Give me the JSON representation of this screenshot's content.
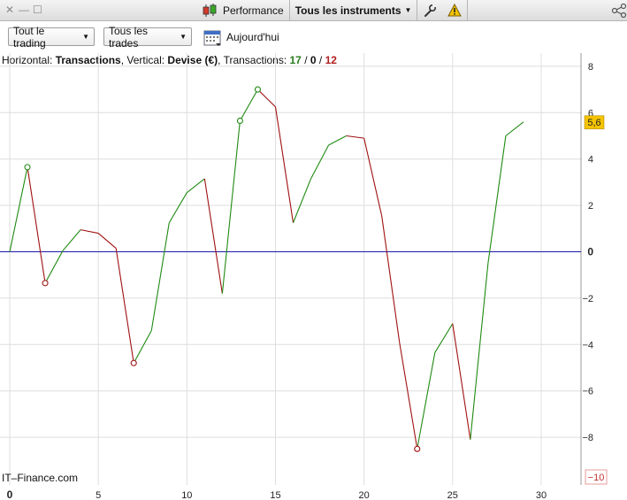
{
  "toolbar": {
    "performance_label": "Performance",
    "instruments_label": "Tous les instruments"
  },
  "filters": {
    "trading_label": "Tout le trading",
    "trades_label": "Tous les trades",
    "date_label": "Aujourd'hui"
  },
  "info": {
    "horizontal_prefix": "Horizontal: ",
    "horizontal_value": "Transactions",
    "vertical_prefix": ", Vertical: ",
    "vertical_value": "Devise (€)",
    "transactions_prefix": ", Transactions: ",
    "wins": "17",
    "sep1": " / ",
    "neutral": "0",
    "sep2": " / ",
    "losses": "12"
  },
  "watermark": "IT–Finance.com",
  "colors": {
    "up": "#1f8a12",
    "down": "#a01010",
    "zero_line": "#1a1aa8",
    "last_value_badge": "#f5c400"
  },
  "chart_data": {
    "type": "line",
    "xlim": [
      0,
      31
    ],
    "ylim": [
      -10.5,
      8.3
    ],
    "x_ticks": [
      0,
      5,
      10,
      15,
      20,
      25,
      30
    ],
    "y_ticks": [
      8,
      6,
      4,
      2,
      0,
      -2,
      -4,
      -6,
      -8
    ],
    "grid": true,
    "last_value_label": "5,6",
    "min_label": "-10",
    "x": [
      0,
      1,
      2,
      3,
      4,
      5,
      6,
      7,
      8,
      9,
      10,
      11,
      12,
      13,
      14,
      15,
      16,
      17,
      18,
      19,
      20,
      21,
      22,
      23,
      24,
      25,
      26,
      27,
      28,
      29
    ],
    "y": [
      0,
      3.65,
      -1.35,
      0.05,
      0.95,
      0.8,
      0.15,
      -4.8,
      -3.4,
      1.25,
      2.55,
      3.15,
      -1.8,
      5.65,
      7.0,
      6.25,
      1.25,
      3.15,
      4.6,
      5.0,
      4.9,
      1.55,
      -3.9,
      -8.5,
      -4.35,
      -3.1,
      -8.1,
      -0.5,
      5.0,
      5.6
    ],
    "markers": [
      {
        "x": 1,
        "y": 3.65
      },
      {
        "x": 2,
        "y": -1.35
      },
      {
        "x": 7,
        "y": -4.8
      },
      {
        "x": 13,
        "y": 5.65
      },
      {
        "x": 14,
        "y": 7.0
      },
      {
        "x": 23,
        "y": -8.5
      }
    ]
  }
}
